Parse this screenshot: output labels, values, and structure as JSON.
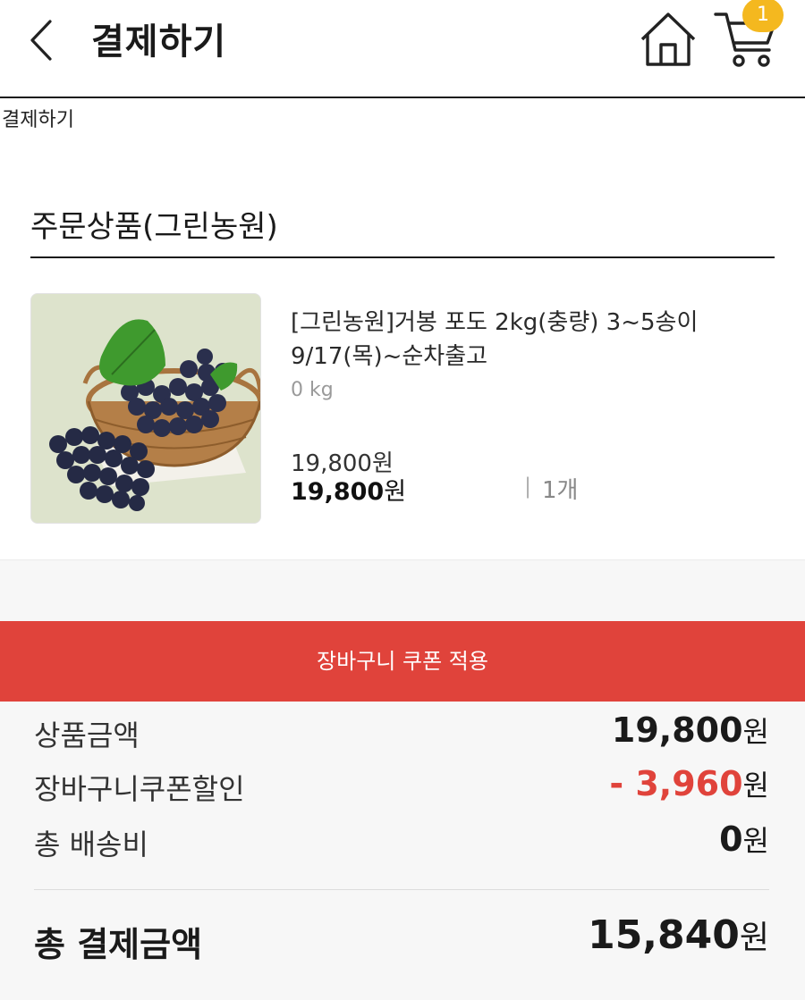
{
  "header": {
    "title": "결제하기",
    "cart_count": "1"
  },
  "breadcrumb": "결제하기",
  "section": {
    "title": "주문상품(그린농원)"
  },
  "product": {
    "name": "[그린농원]거봉 포도 2kg(충량) 3~5송이 9/17(목)~순차출고",
    "weight": "0 kg",
    "price_original": "19,800원",
    "price_amount": "19,800",
    "price_unit": "원",
    "qty_separator": "|",
    "quantity": "1개"
  },
  "coupon_button": "장바구니 쿠폰 적용",
  "summary": {
    "rows": [
      {
        "label": "상품금액",
        "amount": "19,800",
        "unit": "원"
      },
      {
        "label": "장바구니쿠폰할인",
        "amount": "- 3,960",
        "unit": "원"
      },
      {
        "label": "총 배송비",
        "amount": "0",
        "unit": "원"
      }
    ],
    "total_label": "총 결제금액",
    "total_amount": "15,840",
    "total_unit": "원"
  },
  "colors": {
    "accent_red": "#e0433b",
    "badge_yellow": "#f4b81f"
  },
  "icons": [
    "chevron-left-icon",
    "home-icon",
    "cart-icon"
  ]
}
